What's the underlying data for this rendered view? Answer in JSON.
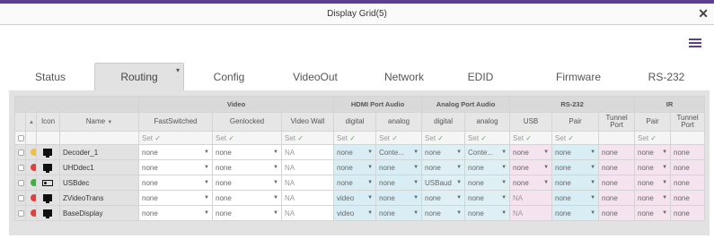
{
  "window": {
    "title": "Display Grid(5)"
  },
  "tabs": [
    "Status",
    "Routing",
    "Config",
    "VideoOut",
    "Network",
    "EDID",
    "Firmware",
    "RS-232"
  ],
  "active_tab": "Routing",
  "group_headers": {
    "video": "Video",
    "hdmi_audio": "HDMI Port Audio",
    "analog_audio": "Analog Port Audio",
    "rs232": "RS-232",
    "ir": "IR"
  },
  "columns": {
    "icon": "Icon",
    "name": "Name",
    "fast_switched": "FastSwitched",
    "genlocked": "Genlocked",
    "video_wall": "Video Wall",
    "hdmi_digital": "digital",
    "hdmi_analog": "analog",
    "analog_digital": "digital",
    "analog_analog": "analog",
    "rs_usb": "USB",
    "rs_pair": "Pair",
    "rs_tunnel": "Tunnel Port",
    "ir_pair": "Pair",
    "ir_tunnel": "Tunnel Port"
  },
  "set_label": "Set",
  "colors": {
    "brand": "#5c3f92",
    "hdmi_tint": "#d8eef4",
    "rs_tint": "#f5e3f0"
  },
  "rows": [
    {
      "status_color": "#f0c040",
      "device_icon": "monitor-icon",
      "name": "Decoder_1",
      "fast": "none",
      "gen": "none",
      "wall": "NA",
      "h_dig": "none",
      "h_ana": "Conte...",
      "a_dig": "none",
      "a_ana": "Conte...",
      "usb": "none",
      "rs_pair": "none",
      "rs_tun": "none",
      "ir_pair": "none",
      "ir_tun": "none"
    },
    {
      "status_color": "#e04040",
      "device_icon": "monitor-icon",
      "name": "UHDdec1",
      "fast": "none",
      "gen": "none",
      "wall": "NA",
      "h_dig": "none",
      "h_ana": "none",
      "a_dig": "none",
      "a_ana": "none",
      "usb": "none",
      "rs_pair": "none",
      "rs_tun": "none",
      "ir_pair": "none",
      "ir_tun": "none"
    },
    {
      "status_color": "#40b040",
      "device_icon": "receiver-icon",
      "name": "USBdec",
      "fast": "none",
      "gen": "none",
      "wall": "NA",
      "h_dig": "none",
      "h_ana": "none",
      "a_dig": "USBaud",
      "a_ana": "none",
      "usb": "none",
      "rs_pair": "none",
      "rs_tun": "none",
      "ir_pair": "none",
      "ir_tun": "none"
    },
    {
      "status_color": "#e04040",
      "device_icon": "monitor-icon",
      "name": "ZVideoTrans",
      "fast": "none",
      "gen": "none",
      "wall": "NA",
      "h_dig": "video",
      "h_ana": "none",
      "a_dig": "none",
      "a_ana": "none",
      "usb": "NA",
      "rs_pair": "none",
      "rs_tun": "none",
      "ir_pair": "none",
      "ir_tun": "none"
    },
    {
      "status_color": "#e04040",
      "device_icon": "monitor-icon",
      "name": "BaseDisplay",
      "fast": "none",
      "gen": "none",
      "wall": "NA",
      "h_dig": "video",
      "h_ana": "none",
      "a_dig": "none",
      "a_ana": "none",
      "usb": "NA",
      "rs_pair": "none",
      "rs_tun": "none",
      "ir_pair": "none",
      "ir_tun": "none"
    }
  ]
}
